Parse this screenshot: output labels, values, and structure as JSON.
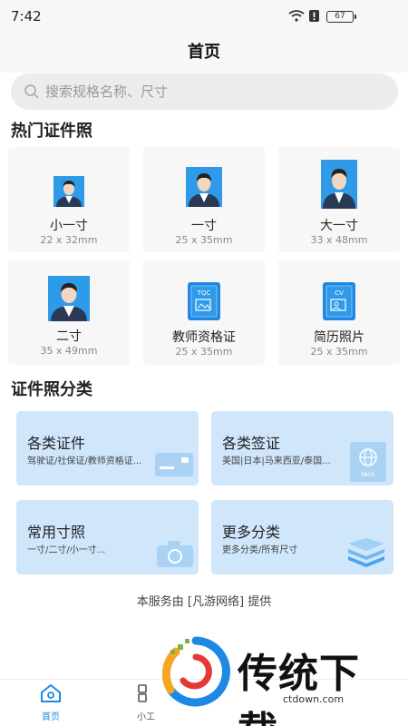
{
  "status": {
    "time": "7:42",
    "battery": "67"
  },
  "header": {
    "title": "首页"
  },
  "search": {
    "placeholder": "搜索规格名称、尺寸"
  },
  "hot": {
    "title": "热门证件照",
    "items": [
      {
        "name": "小一寸",
        "size": "22 x 32mm",
        "icon": "portrait-icon"
      },
      {
        "name": "一寸",
        "size": "25 x 35mm",
        "icon": "portrait-icon"
      },
      {
        "name": "大一寸",
        "size": "33 x 48mm",
        "icon": "portrait-icon"
      },
      {
        "name": "二寸",
        "size": "35 x 49mm",
        "icon": "portrait-icon"
      },
      {
        "name": "教师资格证",
        "size": "25 x 35mm",
        "icon": "certificate-icon",
        "badge": "TQC"
      },
      {
        "name": "简历照片",
        "size": "25 x 35mm",
        "icon": "resume-icon",
        "badge": "CV"
      }
    ]
  },
  "categories": {
    "title": "证件照分类",
    "items": [
      {
        "title": "各类证件",
        "desc": "驾驶证/社保证/教师资格证...",
        "icon": "card-icon"
      },
      {
        "title": "各类签证",
        "desc": "美国|日本|马来西亚/泰国...",
        "icon": "passport-icon",
        "badge": "PASS"
      },
      {
        "title": "常用寸照",
        "desc": "一寸/二寸/小一寸...",
        "icon": "camera-icon"
      },
      {
        "title": "更多分类",
        "desc": "更多分类/所有尺寸",
        "icon": "layers-icon"
      }
    ]
  },
  "footer": {
    "note": "本服务由 [凡游网络] 提供"
  },
  "tabs": [
    {
      "label": "首页",
      "icon": "home-icon",
      "active": true
    },
    {
      "label": "小工",
      "icon": "tools-icon",
      "active": false
    }
  ],
  "watermark": {
    "text": "传统下载",
    "url": "ctdown.com"
  },
  "colors": {
    "accent": "#1e88e5",
    "card_bg": "#cfe6fb",
    "photo_bg": "#2f9ae8"
  }
}
